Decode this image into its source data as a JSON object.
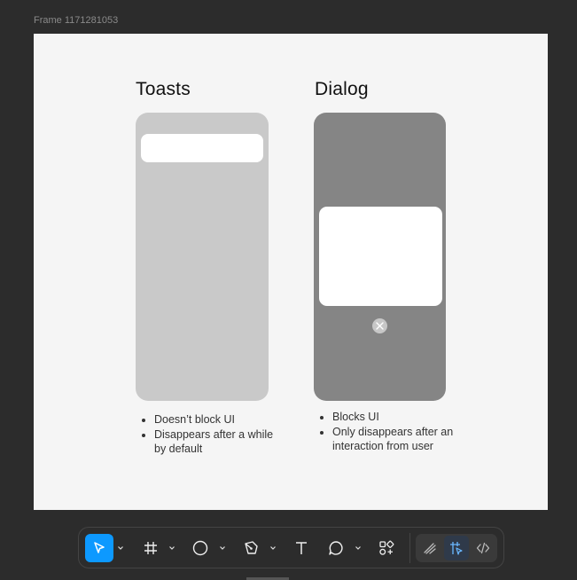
{
  "frame": {
    "label": "Frame 1171281053"
  },
  "toasts": {
    "title": "Toasts",
    "bullets": [
      "Doesn’t block UI",
      "Disappears after a while by default"
    ]
  },
  "dialog": {
    "title": "Dialog",
    "bullets": [
      "Blocks UI",
      "Only disappears after an interaction from user"
    ]
  },
  "toolbar": {
    "tools": [
      "move-tool",
      "frame-tool",
      "ellipse-tool",
      "pen-tool",
      "text-tool",
      "comment-tool",
      "actions-tool"
    ],
    "modes": [
      "draw-mode",
      "design-mode",
      "dev-mode"
    ],
    "selected_tool": "move-tool",
    "selected_mode": "design-mode"
  },
  "colors": {
    "canvas": "#2c2c2c",
    "frame": "#f5f5f5",
    "toast_phone": "#c9c9c9",
    "dialog_phone": "#858585",
    "accent": "#0d99ff"
  }
}
